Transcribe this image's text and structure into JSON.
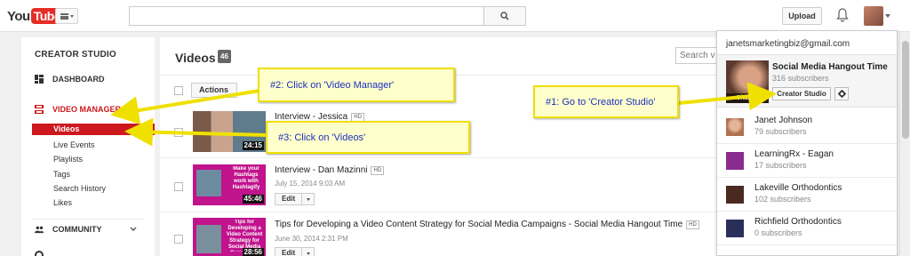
{
  "header": {
    "logo_you": "You",
    "logo_tube": "Tube",
    "search_placeholder": "",
    "upload_label": "Upload"
  },
  "sidebar": {
    "title": "CREATOR STUDIO",
    "dashboard": "DASHBOARD",
    "video_manager": "VIDEO MANAGER",
    "sub_items": [
      "Videos",
      "Live Events",
      "Playlists",
      "Tags",
      "Search History",
      "Likes"
    ],
    "community": "COMMUNITY"
  },
  "main": {
    "title": "Videos",
    "count": "46",
    "search_placeholder": "Search vi",
    "actions_label": "Actions",
    "edit_label": "Edit",
    "videos": [
      {
        "title": "Interview - Jessica",
        "hd": "HD",
        "date": "",
        "duration": "24:15"
      },
      {
        "title": "Interview - Dan Mazinni",
        "hd": "HD",
        "date": "July 15, 2014 9:03 AM",
        "duration": "45:46",
        "thumb_text": "Make your Hashtags work with Hashtagify"
      },
      {
        "title": "Tips for Developing a Video Content Strategy for Social Media Campaigns - Social Media Hangout Time",
        "hd": "HD",
        "date": "June 30, 2014 2:31 PM",
        "duration": "28:56",
        "thumb_text": "Tips for Developing a Video Content Strategy for Social Media Campaigns"
      }
    ]
  },
  "account_menu": {
    "email": "janetsmarketingbiz@gmail.com",
    "current": {
      "name": "Social Media Hangout Time",
      "subs": "316 subscribers",
      "change_label": "Change"
    },
    "creator_studio_label": "Creator Studio",
    "accounts": [
      {
        "name": "Janet Johnson",
        "subs": "79 subscribers"
      },
      {
        "name": "LearningRx - Eagan",
        "subs": "17 subscribers"
      },
      {
        "name": "Lakeville Orthodontics",
        "subs": "102 subscribers"
      },
      {
        "name": "Richfield Orthodontics",
        "subs": "0 subscribers"
      }
    ]
  },
  "annotations": {
    "step1": "#1: Go to 'Creator Studio'",
    "step2": "#2: Click on 'Video Manager'",
    "step3": "#3: Click on 'Videos'"
  },
  "colors": {
    "accent_red": "#cc181e",
    "callout_bg": "#ffffcc",
    "callout_border": "#f0e000",
    "callout_text": "#1c2fbf"
  }
}
